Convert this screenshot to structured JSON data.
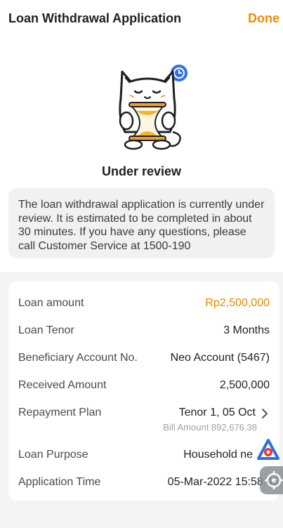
{
  "header": {
    "title": "Loan Withdrawal Application",
    "done_label": "Done"
  },
  "status": {
    "title": "Under review",
    "notice": "The loan withdrawal application is currently under review. It is estimated to be completed in about 30 minutes. If you have any questions, please call Customer Service at 1500-190"
  },
  "details": {
    "loan_amount": {
      "label": "Loan amount",
      "value": "Rp2,500,000"
    },
    "loan_tenor": {
      "label": "Loan Tenor",
      "value": "3 Months"
    },
    "beneficiary": {
      "label": "Beneficiary Account No.",
      "value": "Neo Account (5467)"
    },
    "received": {
      "label": "Received Amount",
      "value": "2,500,000"
    },
    "repayment": {
      "label": "Repayment Plan",
      "value": "Tenor 1, 05 Oct",
      "sub": "Bill Amount 892,676.38"
    },
    "purpose": {
      "label": "Loan Purpose",
      "value": "Household ne"
    },
    "app_time": {
      "label": "Application Time",
      "value": "05-Mar-2022 15:58:45"
    }
  },
  "colors": {
    "accent": "#f08c00",
    "amount": "#e58a00",
    "clock": "#2f6fe4"
  },
  "icons": [
    "cat-hourglass-illustration",
    "clock-icon",
    "chevron-right-icon",
    "assistant-icon",
    "settings-icon"
  ]
}
